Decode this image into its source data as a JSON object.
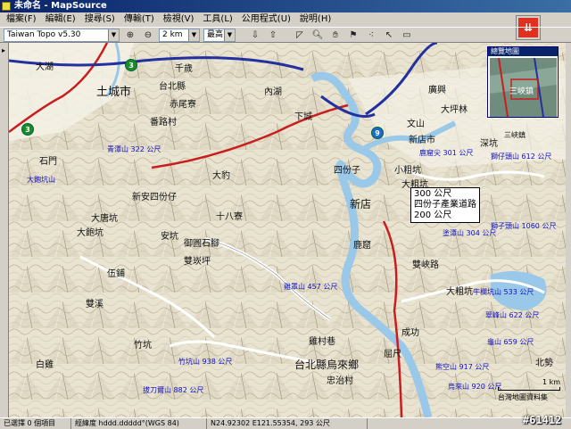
{
  "window": {
    "title": "未命名 - MapSource"
  },
  "menu": [
    {
      "label": "檔案(F)"
    },
    {
      "label": "編輯(E)"
    },
    {
      "label": "搜尋(S)"
    },
    {
      "label": "傳輸(T)"
    },
    {
      "label": "檢視(V)"
    },
    {
      "label": "工具(L)"
    },
    {
      "label": "公用程式(U)"
    },
    {
      "label": "說明(H)"
    }
  ],
  "toolbar": {
    "map_product": "Taiwan Topo v5.30",
    "zoom_scale": "2 km",
    "detail_level": "最高"
  },
  "overview": {
    "title": "總覽地圖",
    "place": "三峽鎮"
  },
  "route_label": {
    "line1": "300 公尺",
    "line2": "四份子產業道路",
    "line3": "200 公尺"
  },
  "map_labels": [
    {
      "text": "大湖",
      "cls": ""
    },
    {
      "text": "土城市",
      "cls": ""
    },
    {
      "text": "千歲",
      "cls": ""
    },
    {
      "text": "台北縣",
      "cls": ""
    },
    {
      "text": "赤尾寮",
      "cls": ""
    },
    {
      "text": "番路村",
      "cls": ""
    },
    {
      "text": "石門",
      "cls": ""
    },
    {
      "text": "新安四份仔",
      "cls": ""
    },
    {
      "text": "大唐坑",
      "cls": ""
    },
    {
      "text": "安坑",
      "cls": ""
    },
    {
      "text": "御圓石腳",
      "cls": ""
    },
    {
      "text": "十八寮",
      "cls": ""
    },
    {
      "text": "雙崁坪",
      "cls": ""
    },
    {
      "text": "伍鋪",
      "cls": ""
    },
    {
      "text": "雙溪",
      "cls": ""
    },
    {
      "text": "大豹",
      "cls": ""
    },
    {
      "text": "竹坑",
      "cls": ""
    },
    {
      "text": "白雞",
      "cls": ""
    },
    {
      "text": "雞村巷",
      "cls": ""
    },
    {
      "text": "新店",
      "cls": ""
    },
    {
      "text": "四份子",
      "cls": ""
    },
    {
      "text": "大粗坑",
      "cls": ""
    },
    {
      "text": "大飽坑",
      "cls": ""
    },
    {
      "text": "三峽鎮",
      "cls": ""
    },
    {
      "text": "內湖",
      "cls": ""
    },
    {
      "text": "鹿窟",
      "cls": ""
    },
    {
      "text": "小粗坑",
      "cls": ""
    },
    {
      "text": "大粗坑",
      "cls": ""
    },
    {
      "text": "雙峽路",
      "cls": ""
    },
    {
      "text": "台北縣烏來鄉",
      "cls": ""
    },
    {
      "text": "忠治村",
      "cls": ""
    },
    {
      "text": "屈尺",
      "cls": ""
    },
    {
      "text": "成功",
      "cls": ""
    },
    {
      "text": "北勢",
      "cls": ""
    },
    {
      "text": "廣興",
      "cls": ""
    },
    {
      "text": "文山",
      "cls": ""
    },
    {
      "text": "大坪林",
      "cls": ""
    },
    {
      "text": "新店市",
      "cls": ""
    },
    {
      "text": "深坑",
      "cls": ""
    },
    {
      "text": "下城",
      "cls": ""
    },
    {
      "text": "青潭山 322 公尺",
      "cls": "peak"
    },
    {
      "text": "鹿窟尖 301 公尺",
      "cls": "peak"
    },
    {
      "text": "大飽坑山",
      "cls": "peak"
    },
    {
      "text": "獅仔頭山 612 公尺",
      "cls": "peak"
    },
    {
      "text": "牛欄坑山 533 公尺",
      "cls": "peak"
    },
    {
      "text": "竹坑山 938 公尺",
      "cls": "peak"
    },
    {
      "text": "雞罩山 457 公尺",
      "cls": "peak"
    },
    {
      "text": "熊空山 917 公尺",
      "cls": "peak"
    },
    {
      "text": "拔刀爾山 882 公尺",
      "cls": "peak"
    },
    {
      "text": "烏來山 920 公尺",
      "cls": "peak"
    },
    {
      "text": "龜山 659 公尺",
      "cls": "peak"
    },
    {
      "text": "塗潭山 304 公尺",
      "cls": "peak"
    },
    {
      "text": "獅子頭山 1060 公尺",
      "cls": "peak"
    },
    {
      "text": "翠峰山 622 公尺",
      "cls": "peak"
    }
  ],
  "shields": [
    {
      "label": "3",
      "color": "green"
    },
    {
      "label": "3",
      "color": "green"
    },
    {
      "label": "9",
      "color": "blue"
    }
  ],
  "scale": {
    "label": "1 km",
    "copyright": "台灣地圖資料集"
  },
  "status": {
    "selection": "已選擇 0 個項目",
    "format": "經緯度 hddd.ddddd°(WGS 84)",
    "coords": "N24.92302 E121.55354, 293 公尺"
  },
  "watermark": "#61412"
}
